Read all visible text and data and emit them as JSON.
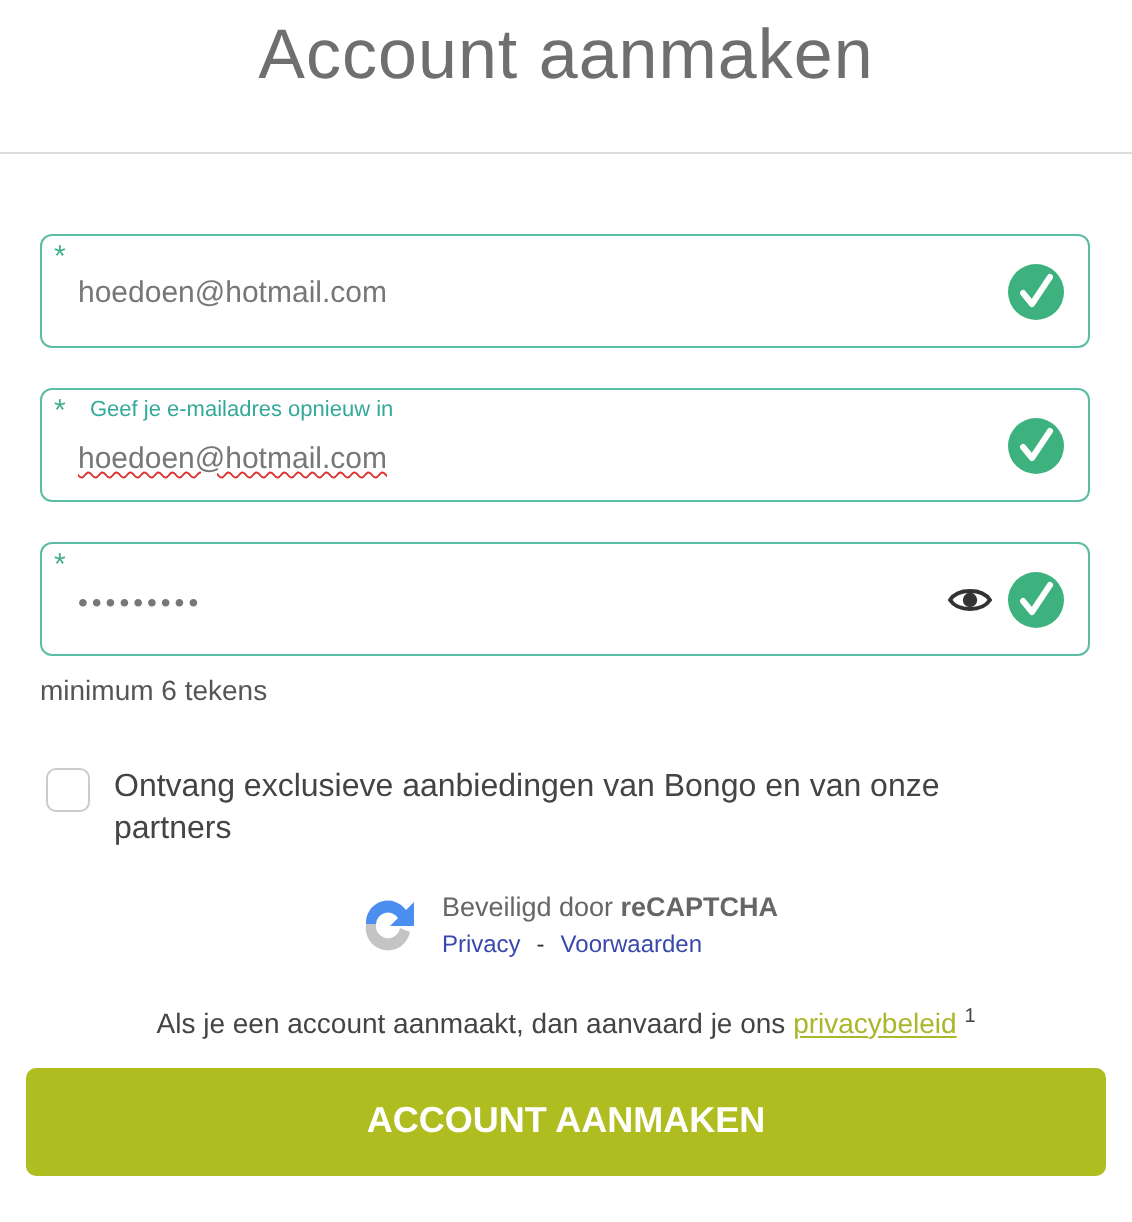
{
  "title": "Account aanmaken",
  "fields": [
    {
      "kind": "email",
      "required_mark": "*",
      "value": "hoedoen@hotmail.com",
      "valid": true,
      "misspelled": false
    },
    {
      "kind": "email",
      "required_mark": "*",
      "label": "Geef je e-mailadres opnieuw in",
      "value": "hoedoen@hotmail.com",
      "valid": true,
      "misspelled": true
    },
    {
      "kind": "password",
      "required_mark": "*",
      "value": "•••••••••",
      "valid": true,
      "misspelled": false
    }
  ],
  "password_hint": "minimum 6 tekens",
  "newsletter": {
    "label": "Ontvang exclusieve aanbiedingen van Bongo en van onze partners",
    "checked": false
  },
  "recaptcha": {
    "text": "Beveiligd door **reCAPTCHA**",
    "links": [
      "Privacy",
      "Voorwaarden"
    ],
    "separator": "-"
  },
  "terms": {
    "text": "Als je een account aanmaakt, dan aanvaard je ons",
    "link": "privacybeleid",
    "footnote": "1"
  },
  "submit_button": "ACCOUNT AANMAKEN"
}
